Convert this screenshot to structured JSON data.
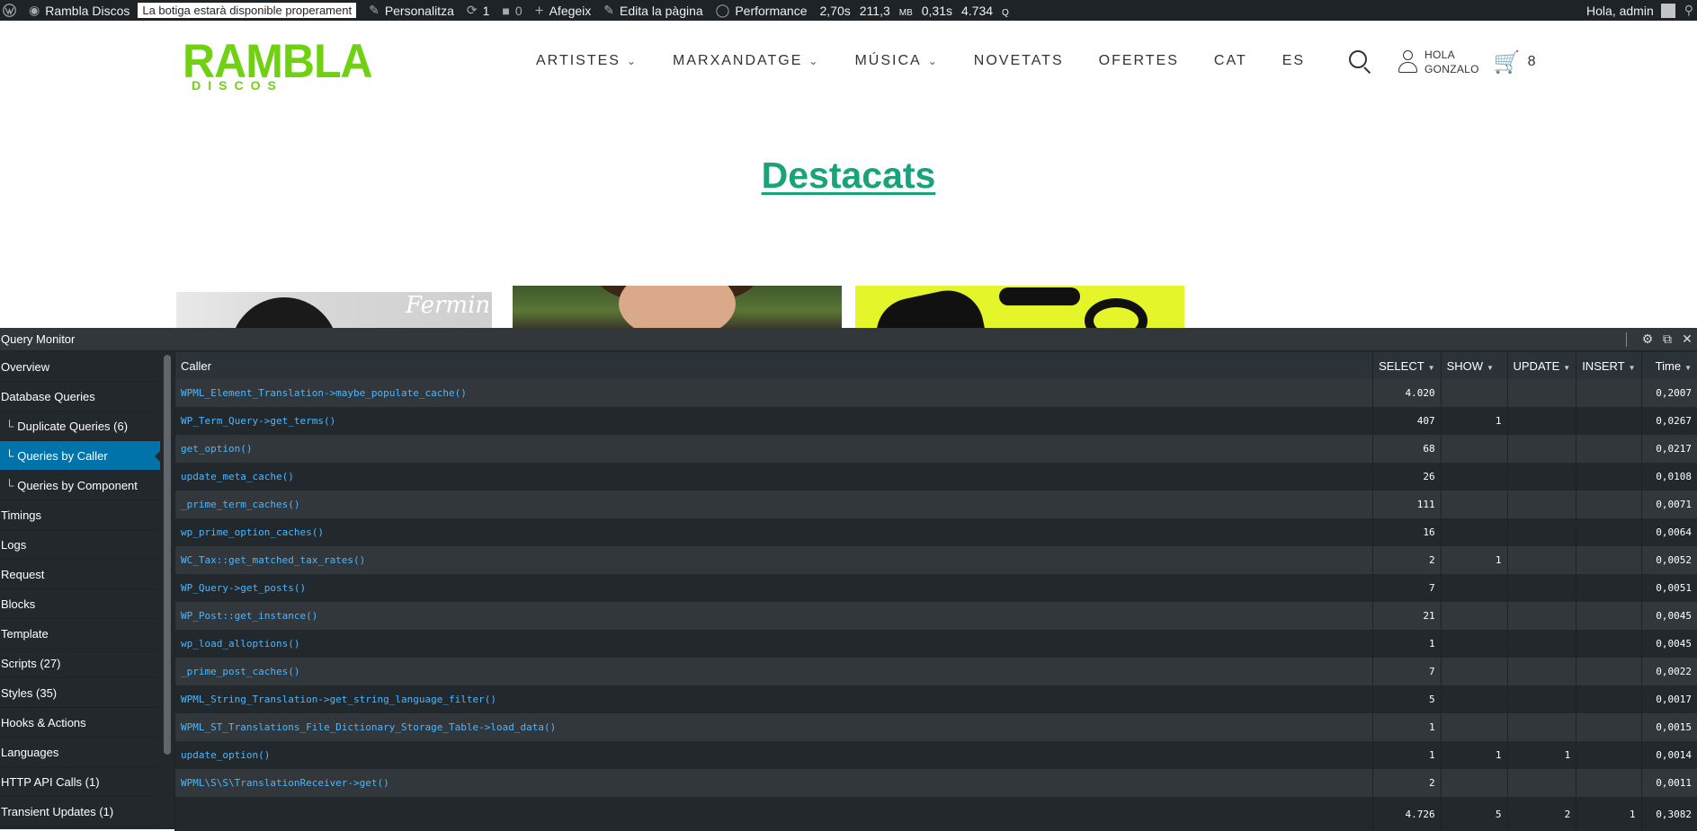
{
  "adminbar": {
    "site_name": "Rambla Discos",
    "notice": "La botiga estarà disponible properament",
    "customize": "Personalitza",
    "updates_count": "1",
    "comments_count": "0",
    "new_label": "Afegeix",
    "edit_page": "Edita la pàgina",
    "performance": "Performance",
    "perf_time": "2,70s",
    "perf_mem": "211,3",
    "perf_mem_unit": "MB",
    "perf_db_time": "0,31s",
    "perf_queries": "4.734",
    "perf_queries_unit": "Q",
    "greeting": "Hola, admin"
  },
  "header": {
    "logo_main": "RAMBLA",
    "logo_sub": "DISCOS",
    "nav": [
      {
        "label": "ARTISTES",
        "has_dropdown": true
      },
      {
        "label": "MARXANDATGE",
        "has_dropdown": true
      },
      {
        "label": "MÚSICA",
        "has_dropdown": true
      },
      {
        "label": "NOVETATS",
        "has_dropdown": false
      },
      {
        "label": "OFERTES",
        "has_dropdown": false
      },
      {
        "label": "CAT",
        "has_dropdown": false
      },
      {
        "label": "ES",
        "has_dropdown": false
      }
    ],
    "user_line1": "HOLA",
    "user_line2": "GONZALO",
    "cart_count": "8"
  },
  "page": {
    "title": "Destacats",
    "card1_script": "Fermin"
  },
  "qm": {
    "title": "Query Monitor",
    "sidebar": [
      {
        "label": "Overview",
        "sub": false,
        "active": false
      },
      {
        "label": "Database Queries",
        "sub": false,
        "active": false
      },
      {
        "label": "Duplicate Queries (6)",
        "sub": true,
        "active": false
      },
      {
        "label": "Queries by Caller",
        "sub": true,
        "active": true
      },
      {
        "label": "Queries by Component",
        "sub": true,
        "active": false
      },
      {
        "label": "Timings",
        "sub": false,
        "active": false
      },
      {
        "label": "Logs",
        "sub": false,
        "active": false
      },
      {
        "label": "Request",
        "sub": false,
        "active": false
      },
      {
        "label": "Blocks",
        "sub": false,
        "active": false
      },
      {
        "label": "Template",
        "sub": false,
        "active": false
      },
      {
        "label": "Scripts (27)",
        "sub": false,
        "active": false
      },
      {
        "label": "Styles (35)",
        "sub": false,
        "active": false
      },
      {
        "label": "Hooks & Actions",
        "sub": false,
        "active": false
      },
      {
        "label": "Languages",
        "sub": false,
        "active": false
      },
      {
        "label": "HTTP API Calls (1)",
        "sub": false,
        "active": false
      },
      {
        "label": "Transient Updates (1)",
        "sub": false,
        "active": false
      }
    ],
    "columns": [
      "Caller",
      "SELECT",
      "SHOW",
      "UPDATE",
      "INSERT",
      "Time"
    ],
    "rows": [
      {
        "caller": "WPML_Element_Translation->maybe_populate_cache()",
        "select": "4.020",
        "show": "",
        "update": "",
        "insert": "",
        "time": "0,2007"
      },
      {
        "caller": "WP_Term_Query->get_terms()",
        "select": "407",
        "show": "1",
        "update": "",
        "insert": "",
        "time": "0,0267"
      },
      {
        "caller": "get_option()",
        "select": "68",
        "show": "",
        "update": "",
        "insert": "",
        "time": "0,0217"
      },
      {
        "caller": "update_meta_cache()",
        "select": "26",
        "show": "",
        "update": "",
        "insert": "",
        "time": "0,0108"
      },
      {
        "caller": "_prime_term_caches()",
        "select": "111",
        "show": "",
        "update": "",
        "insert": "",
        "time": "0,0071"
      },
      {
        "caller": "wp_prime_option_caches()",
        "select": "16",
        "show": "",
        "update": "",
        "insert": "",
        "time": "0,0064"
      },
      {
        "caller": "WC_Tax::get_matched_tax_rates()",
        "select": "2",
        "show": "1",
        "update": "",
        "insert": "",
        "time": "0,0052"
      },
      {
        "caller": "WP_Query->get_posts()",
        "select": "7",
        "show": "",
        "update": "",
        "insert": "",
        "time": "0,0051"
      },
      {
        "caller": "WP_Post::get_instance()",
        "select": "21",
        "show": "",
        "update": "",
        "insert": "",
        "time": "0,0045"
      },
      {
        "caller": "wp_load_alloptions()",
        "select": "1",
        "show": "",
        "update": "",
        "insert": "",
        "time": "0,0045"
      },
      {
        "caller": "_prime_post_caches()",
        "select": "7",
        "show": "",
        "update": "",
        "insert": "",
        "time": "0,0022"
      },
      {
        "caller": "WPML_String_Translation->get_string_language_filter()",
        "select": "5",
        "show": "",
        "update": "",
        "insert": "",
        "time": "0,0017"
      },
      {
        "caller": "WPML_ST_Translations_File_Dictionary_Storage_Table->load_data()",
        "select": "1",
        "show": "",
        "update": "",
        "insert": "",
        "time": "0,0015"
      },
      {
        "caller": "update_option()",
        "select": "1",
        "show": "1",
        "update": "1",
        "insert": "",
        "time": "0,0014"
      },
      {
        "caller": "WPML\\S\\S\\TranslationReceiver->get()",
        "select": "2",
        "show": "",
        "update": "",
        "insert": "",
        "time": "0,0011"
      }
    ],
    "totals": {
      "select": "4.726",
      "show": "5",
      "update": "2",
      "insert": "1",
      "time": "0,3082"
    }
  }
}
